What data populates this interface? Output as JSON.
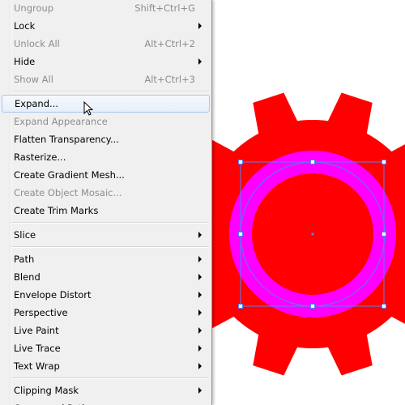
{
  "menu": {
    "items": [
      {
        "label": "Ungroup",
        "shortcut": "Shift+Ctrl+G",
        "disabled": true
      },
      {
        "label": "Lock",
        "submenu": true
      },
      {
        "label": "Unlock All",
        "shortcut": "Alt+Ctrl+2",
        "disabled": true
      },
      {
        "label": "Hide",
        "submenu": true
      },
      {
        "label": "Show All",
        "shortcut": "Alt+Ctrl+3",
        "disabled": true
      },
      {
        "separator": true
      },
      {
        "label": "Expand...",
        "hover": true
      },
      {
        "label": "Expand Appearance",
        "disabled": true
      },
      {
        "label": "Flatten Transparency..."
      },
      {
        "label": "Rasterize..."
      },
      {
        "label": "Create Gradient Mesh..."
      },
      {
        "label": "Create Object Mosaic...",
        "disabled": true
      },
      {
        "label": "Create Trim Marks"
      },
      {
        "separator": true
      },
      {
        "label": "Slice",
        "submenu": true
      },
      {
        "separator": true
      },
      {
        "label": "Path",
        "submenu": true
      },
      {
        "label": "Blend",
        "submenu": true
      },
      {
        "label": "Envelope Distort",
        "submenu": true
      },
      {
        "label": "Perspective",
        "submenu": true
      },
      {
        "label": "Live Paint",
        "submenu": true
      },
      {
        "label": "Live Trace",
        "submenu": true
      },
      {
        "label": "Text Wrap",
        "submenu": true
      },
      {
        "separator": true
      },
      {
        "label": "Clipping Mask",
        "submenu": true
      },
      {
        "label": "Compound Path",
        "submenu": true
      }
    ]
  },
  "artwork": {
    "gear_color": "#ff0000",
    "ring_color": "#ff00ff",
    "selection_color": "#4f7fff",
    "teeth": 10
  }
}
